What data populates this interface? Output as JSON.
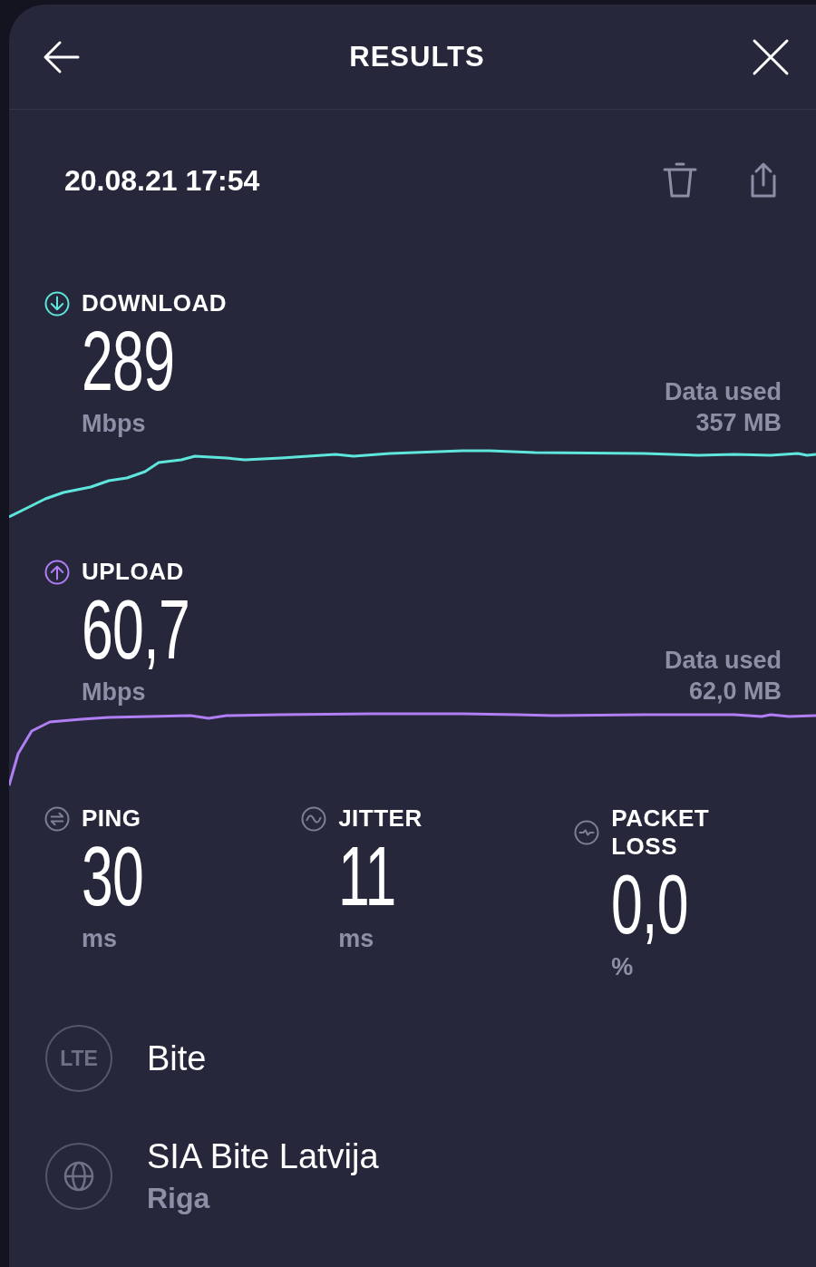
{
  "header": {
    "title": "RESULTS"
  },
  "result": {
    "timestamp": "20.08.21 17:54"
  },
  "speeds": [
    {
      "kind": "download",
      "label": "DOWNLOAD",
      "value": "289",
      "unit": "Mbps",
      "data_label": "Data used",
      "data_value": "357 MB",
      "color": "#5ee6dc"
    },
    {
      "kind": "upload",
      "label": "UPLOAD",
      "value": "60,7",
      "unit": "Mbps",
      "data_label": "Data used",
      "data_value": "62,0 MB",
      "color": "#b07ef5"
    }
  ],
  "stats": [
    {
      "kind": "ping",
      "label": "PING",
      "value": "30",
      "unit": "ms"
    },
    {
      "kind": "jitter",
      "label": "JITTER",
      "value": "11",
      "unit": "ms"
    },
    {
      "kind": "packet_loss",
      "label": "PACKET LOSS",
      "value": "0,0",
      "unit": "%"
    }
  ],
  "connection": [
    {
      "kind": "network",
      "badge": "LTE",
      "name": "Bite"
    },
    {
      "kind": "provider",
      "name": "SIA Bite Latvija",
      "location": "Riga"
    }
  ]
}
